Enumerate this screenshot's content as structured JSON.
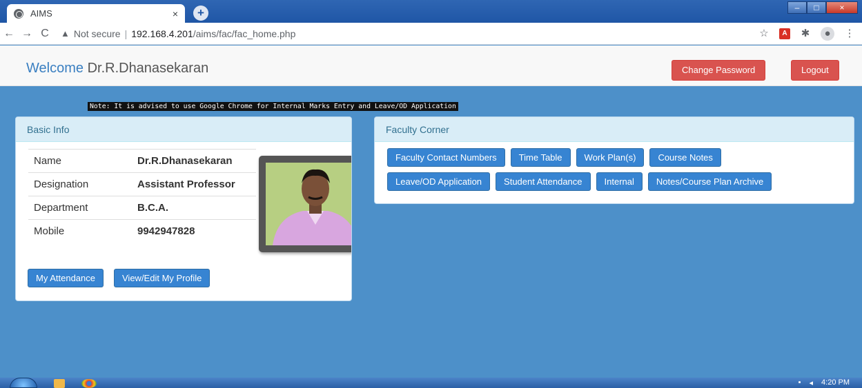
{
  "browser": {
    "tab_title": "AIMS",
    "tab_close": "×",
    "new_tab": "+",
    "back": "←",
    "forward": "→",
    "reload": "C",
    "security_label": "Not secure",
    "url_host": "192.168.4.201",
    "url_path": "/aims/fac/fac_home.php",
    "window_min": "–",
    "window_max": "□",
    "window_close": "×"
  },
  "header": {
    "welcome": "Welcome",
    "user_name": "Dr.R.Dhanasekaran",
    "change_password": "Change Password",
    "logout": "Logout"
  },
  "note": "Note: It is advised to use Google Chrome for Internal Marks Entry and Leave/OD Application",
  "basic_info": {
    "heading": "Basic Info",
    "rows": [
      {
        "label": "Name",
        "value": "Dr.R.Dhanasekaran"
      },
      {
        "label": "Designation",
        "value": "Assistant Professor"
      },
      {
        "label": "Department",
        "value": "B.C.A."
      },
      {
        "label": "Mobile",
        "value": "9942947828"
      }
    ],
    "buttons": [
      "My Attendance",
      "View/Edit My Profile"
    ]
  },
  "faculty_corner": {
    "heading": "Faculty Corner",
    "row1": [
      "Faculty Contact Numbers",
      "Time Table",
      "Work Plan(s)",
      "Course Notes"
    ],
    "row2": [
      "Leave/OD Application",
      "Student Attendance",
      "Internal",
      "Notes/Course Plan Archive"
    ]
  },
  "taskbar": {
    "clock": "4:20 PM"
  },
  "colors": {
    "page_background": "#4d90c9",
    "primary_button": "#3784d2",
    "danger_button": "#d9534f",
    "panel_heading": "#d9edf7"
  }
}
